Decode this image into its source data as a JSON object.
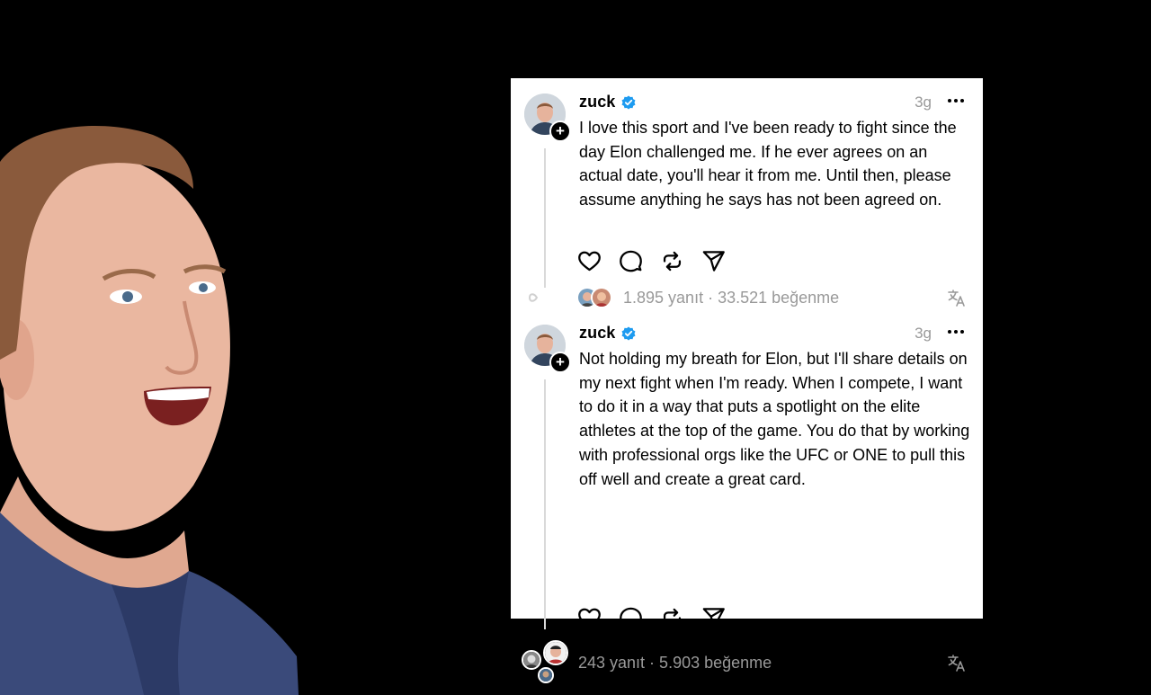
{
  "posts": [
    {
      "username": "zuck",
      "time": "3g",
      "text": "I love this sport and I've been ready to fight since the day Elon challenged me. If he ever agrees on an actual date, you'll hear it from me. Until then, please assume anything he says has not been agreed on.",
      "stats": "1.895 yanıt · 33.521 beğenme"
    },
    {
      "username": "zuck",
      "time": "3g",
      "text": "Not holding my breath for Elon, but I'll share details on my next fight when I'm ready. When I compete, I want to do it in a way that puts a spotlight on the elite athletes at the top of the game. You do that by working with professional orgs like the UFC or ONE to pull this off well and create a great card.",
      "stats": "243 yanıt · 5.903 beğenme"
    }
  ],
  "icons": {
    "follow": "plus-icon",
    "verified": "verified-badge-icon",
    "more": "more-options-icon",
    "like": "heart-icon",
    "reply": "comment-icon",
    "repost": "repost-icon",
    "share": "send-icon",
    "translate": "translate-icon"
  },
  "colors": {
    "verified": "#1d9bf0",
    "muted": "#999999",
    "background": "#000000",
    "card": "#ffffff"
  }
}
